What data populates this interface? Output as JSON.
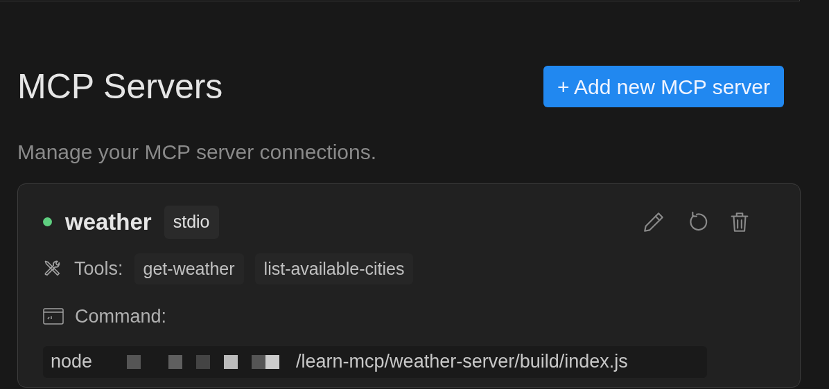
{
  "header": {
    "title": "MCP Servers",
    "add_button": "+ Add new MCP server",
    "subtitle": "Manage your MCP server connections."
  },
  "servers": [
    {
      "name": "weather",
      "color": "#5fcf80",
      "transport": "stdio",
      "tools_label": "Tools:",
      "tools": [
        "get-weather",
        "list-available-cities"
      ],
      "command_label": "Command:",
      "command_program": "node",
      "command_redacted": true,
      "command_path": "/learn-mcp/weather-server/build/index.js"
    }
  ]
}
